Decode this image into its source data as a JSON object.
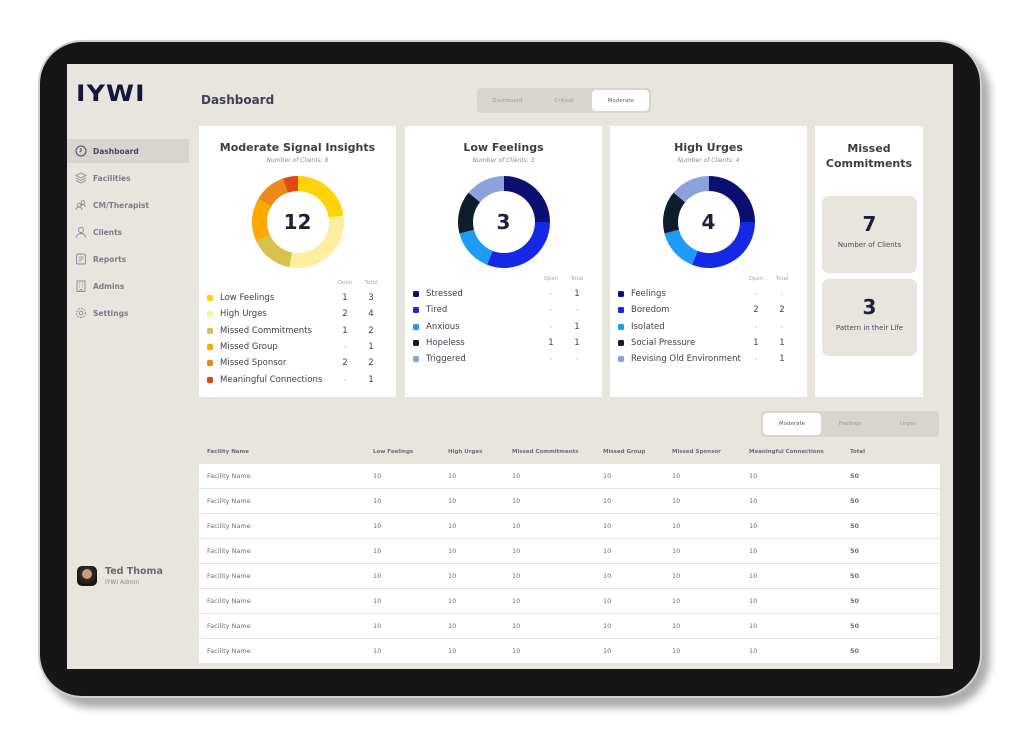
{
  "app": {
    "logo": "IYWI",
    "page_title": "Dashboard"
  },
  "sidebar": {
    "items": [
      {
        "label": "Dashboard",
        "icon": "dashboard-icon",
        "active": true
      },
      {
        "label": "Facilities",
        "icon": "layers-icon",
        "active": false
      },
      {
        "label": "CM/Therapist",
        "icon": "users-icon",
        "active": false
      },
      {
        "label": "Clients",
        "icon": "user-icon",
        "active": false
      },
      {
        "label": "Reports",
        "icon": "report-icon",
        "active": false
      },
      {
        "label": "Admins",
        "icon": "building-icon",
        "active": false
      },
      {
        "label": "Settings",
        "icon": "gear-icon",
        "active": false
      }
    ],
    "user": {
      "name": "Ted Thoma",
      "role": "IYWI Admin"
    }
  },
  "top_tabs": [
    {
      "label": "Dashboard",
      "active": false
    },
    {
      "label": "Critical",
      "active": false
    },
    {
      "label": "Moderate",
      "active": true
    }
  ],
  "cards": [
    {
      "title": "Moderate Signal Insights",
      "subtitle": "Number of Clients: 8",
      "center": "12",
      "col_open": "Open",
      "col_total": "Total",
      "items": [
        {
          "label": "Low Feelings",
          "open": "1",
          "total": "3",
          "color": "#ffd20a"
        },
        {
          "label": "High Urges",
          "open": "2",
          "total": "4",
          "color": "#ffeea0"
        },
        {
          "label": "Missed Commitments",
          "open": "1",
          "total": "2",
          "color": "#d9c24c"
        },
        {
          "label": "Missed Group",
          "open": "-",
          "total": "1",
          "color": "#ffa800"
        },
        {
          "label": "Missed Sponsor",
          "open": "2",
          "total": "2",
          "color": "#eb8a1a"
        },
        {
          "label": "Meaningful Connections",
          "open": "-",
          "total": "1",
          "color": "#de4a12"
        }
      ]
    },
    {
      "title": "Low Feelings",
      "subtitle": "Number of Clients: 3",
      "center": "3",
      "col_open": "Open",
      "col_total": "Total",
      "items": [
        {
          "label": "Stressed",
          "open": "-",
          "total": "1",
          "color": "#0b0f72"
        },
        {
          "label": "Tired",
          "open": "-",
          "total": "-",
          "color": "#1428e6"
        },
        {
          "label": "Anxious",
          "open": "-",
          "total": "1",
          "color": "#1e9cf5"
        },
        {
          "label": "Hopeless",
          "open": "1",
          "total": "1",
          "color": "#0f1c2e"
        },
        {
          "label": "Triggered",
          "open": "-",
          "total": "-",
          "color": "#8ea2da"
        }
      ]
    },
    {
      "title": "High Urges",
      "subtitle": "Number of Clients: 4",
      "center": "4",
      "col_open": "Open",
      "col_total": "Total",
      "items": [
        {
          "label": "Feelings",
          "open": "-",
          "total": "-",
          "color": "#0b0f72"
        },
        {
          "label": "Boredom",
          "open": "2",
          "total": "2",
          "color": "#1428e6"
        },
        {
          "label": "Isolated",
          "open": "-",
          "total": "-",
          "color": "#1e9cf5"
        },
        {
          "label": "Social Pressure",
          "open": "1",
          "total": "1",
          "color": "#0f1c2e"
        },
        {
          "label": "Revising Old Environment",
          "open": "-",
          "total": "1",
          "color": "#8ea2da"
        }
      ]
    }
  ],
  "chart_data": [
    {
      "type": "pie",
      "title": "Moderate Signal Insights",
      "subtitle": "Number of Clients: 8",
      "center_label": "12",
      "categories": [
        "Low Feelings",
        "High Urges",
        "Missed Commitments",
        "Missed Group",
        "Missed Sponsor",
        "Meaningful Connections"
      ],
      "values": [
        3,
        4,
        2,
        2,
        1.5,
        0.7
      ],
      "colors": [
        "#ffd20a",
        "#ffeea0",
        "#d9c24c",
        "#ffa800",
        "#eb8a1a",
        "#de4a12"
      ]
    },
    {
      "type": "pie",
      "title": "Low Feelings",
      "subtitle": "Number of Clients: 3",
      "center_label": "3",
      "categories": [
        "Stressed",
        "Tired",
        "Anxious",
        "Hopeless",
        "Triggered"
      ],
      "values": [
        25,
        31,
        15,
        15,
        14
      ],
      "colors": [
        "#0b0f72",
        "#1428e6",
        "#1e9cf5",
        "#0f1c2e",
        "#8ea2da"
      ]
    },
    {
      "type": "pie",
      "title": "High Urges",
      "subtitle": "Number of Clients: 4",
      "center_label": "4",
      "categories": [
        "Feelings",
        "Boredom",
        "Isolated",
        "Social Pressure",
        "Revising Old Environment"
      ],
      "values": [
        25,
        31,
        15,
        15,
        14
      ],
      "colors": [
        "#0b0f72",
        "#1428e6",
        "#1e9cf5",
        "#0f1c2e",
        "#8ea2da"
      ]
    }
  ],
  "missed": {
    "title_line1": "Missed",
    "title_line2": "Commitments",
    "stats": [
      {
        "value": "7",
        "label": "Number of Clients"
      },
      {
        "value": "3",
        "label": "Pattern in their Life"
      }
    ]
  },
  "bottom_tabs": [
    {
      "label": "Moderate",
      "active": true
    },
    {
      "label": "Feelings",
      "active": false
    },
    {
      "label": "Urges",
      "active": false
    }
  ],
  "table": {
    "headers": [
      "Facility Name",
      "Low Feelings",
      "High Urges",
      "Missed Commitments",
      "Missed Group",
      "Missed Sponsor",
      "Meaningful Connections",
      "Total"
    ],
    "rows": [
      [
        "Facility Name",
        "10",
        "10",
        "10",
        "10",
        "10",
        "10",
        "50"
      ],
      [
        "Facility Name",
        "10",
        "10",
        "10",
        "10",
        "10",
        "10",
        "50"
      ],
      [
        "Facility Name",
        "10",
        "10",
        "10",
        "10",
        "10",
        "10",
        "50"
      ],
      [
        "Facility Name",
        "10",
        "10",
        "10",
        "10",
        "10",
        "10",
        "50"
      ],
      [
        "Facility Name",
        "10",
        "10",
        "10",
        "10",
        "10",
        "10",
        "50"
      ],
      [
        "Facility Name",
        "10",
        "10",
        "10",
        "10",
        "10",
        "10",
        "50"
      ],
      [
        "Facility Name",
        "10",
        "10",
        "10",
        "10",
        "10",
        "10",
        "50"
      ],
      [
        "Facility Name",
        "10",
        "10",
        "10",
        "10",
        "10",
        "10",
        "50"
      ]
    ]
  }
}
